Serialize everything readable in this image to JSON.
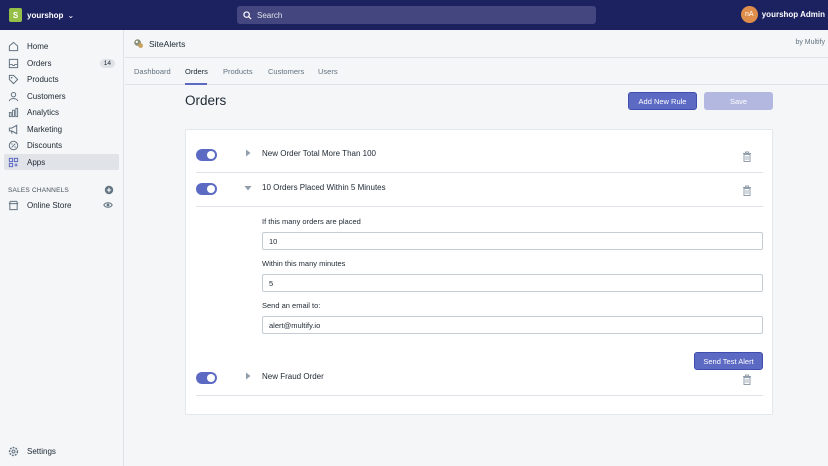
{
  "topbar": {
    "store_name": "yourshop",
    "search_placeholder": "Search",
    "user_initials": "nA",
    "user_name": "yourshop Admin"
  },
  "sidebar": {
    "items": [
      {
        "label": "Home",
        "icon": "home-icon"
      },
      {
        "label": "Orders",
        "icon": "orders-icon",
        "badge": "14"
      },
      {
        "label": "Products",
        "icon": "tag-icon"
      },
      {
        "label": "Customers",
        "icon": "person-icon"
      },
      {
        "label": "Analytics",
        "icon": "bar-chart-icon"
      },
      {
        "label": "Marketing",
        "icon": "megaphone-icon"
      },
      {
        "label": "Discounts",
        "icon": "discount-icon"
      },
      {
        "label": "Apps",
        "icon": "apps-icon",
        "active": true
      }
    ],
    "sales_channels_title": "SALES CHANNELS",
    "online_store_label": "Online Store",
    "settings_label": "Settings"
  },
  "app": {
    "title": "SiteAlerts",
    "by": "by Multify"
  },
  "tabs": [
    {
      "label": "Dashboard"
    },
    {
      "label": "Orders",
      "active": true
    },
    {
      "label": "Products"
    },
    {
      "label": "Customers"
    },
    {
      "label": "Users"
    }
  ],
  "page": {
    "title": "Orders",
    "add_rule_label": "Add New Rule",
    "save_label": "Save"
  },
  "rules": [
    {
      "name": "New Order Total More Than 100",
      "enabled": true,
      "expanded": false
    },
    {
      "name": "10 Orders Placed Within 5 Minutes",
      "enabled": true,
      "expanded": true
    },
    {
      "name": "New Fraud Order",
      "enabled": true,
      "expanded": false
    }
  ],
  "rule_form": {
    "orders_label": "If this many orders are placed",
    "orders_value": "10",
    "minutes_label": "Within this many minutes",
    "minutes_value": "5",
    "email_label": "Send an email to:",
    "email_value": "alert@multify.io",
    "test_alert_label": "Send Test Alert"
  },
  "colors": {
    "topbar": "#1c2260",
    "accent": "#5c6ac4",
    "accent_disabled": "#b3b8e0"
  }
}
